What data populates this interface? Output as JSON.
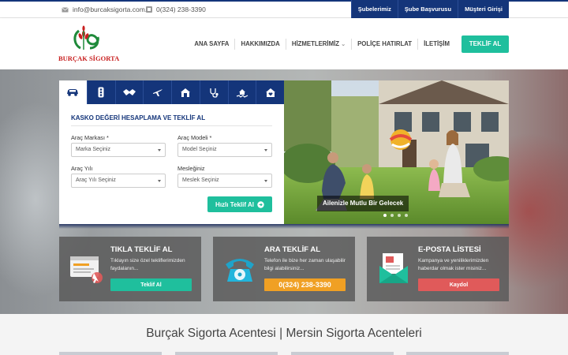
{
  "topbar": {
    "email": "info@burcaksigorta.com.tr",
    "phone": "0(324) 238-3390",
    "links": [
      "Şubelerimiz",
      "Şube Başvurusu",
      "Müşteri Girişi"
    ]
  },
  "logo": {
    "text": "BURÇAK SİGORTA"
  },
  "menu": {
    "items": [
      "ANA SAYFA",
      "HAKKIMIZDA",
      "HİZMETLERİMİZ",
      "POLİÇE HATIRLAT",
      "İLETİŞİM"
    ],
    "cta": "TEKLİF AL"
  },
  "form": {
    "tabs": [
      "car-icon",
      "traffic-light-icon",
      "handshake-icon",
      "plane-icon",
      "house-icon",
      "stethoscope-icon",
      "earthquake-icon",
      "house-heart-icon"
    ],
    "title": "KASKO DEĞERİ HESAPLAMA VE TEKLİF AL",
    "brand_label": "Araç Markası *",
    "brand_value": "Marka Seçiniz",
    "model_label": "Araç Modeli *",
    "model_value": "Model Seçiniz",
    "year_label": "Araç Yılı",
    "year_value": "Araç Yılı Seçiniz",
    "job_label": "Mesleğiniz",
    "job_value": "Meslek Seçiniz",
    "submit": "Hızlı Teklif Al"
  },
  "slider": {
    "caption": "Ailenizle Mutlu Bir Gelecek",
    "slides": 4,
    "active": 1
  },
  "cards": [
    {
      "title": "TIKLA TEKLİF AL",
      "desc": "Tıklayın size özel tekliflerimizden faydalanın...",
      "button": "Teklif Al",
      "color": "#1fbf9d",
      "icon": "form-click-icon"
    },
    {
      "title": "ARA TEKLİF AL",
      "desc": "Telefon ile bize her zaman ulaşabilir bilgi alabilirsiniz...",
      "button": "0(324) 238-3390",
      "color": "#f0a024",
      "icon": "telephone-icon"
    },
    {
      "title": "E-POSTA LİSTESİ",
      "desc": "Kampanya ve yeniliklerimizden haberdar olmak ister misiniz...",
      "button": "Kaydol",
      "color": "#e05a5a",
      "icon": "envelope-icon"
    }
  ],
  "bottom": {
    "title": "Burçak Sigorta Acentesi | Mersin Sigorta Acenteleri"
  },
  "colors": {
    "navy": "#14357a",
    "teal": "#1fbf9d",
    "orange": "#f0a024",
    "red": "#e05a5a"
  }
}
